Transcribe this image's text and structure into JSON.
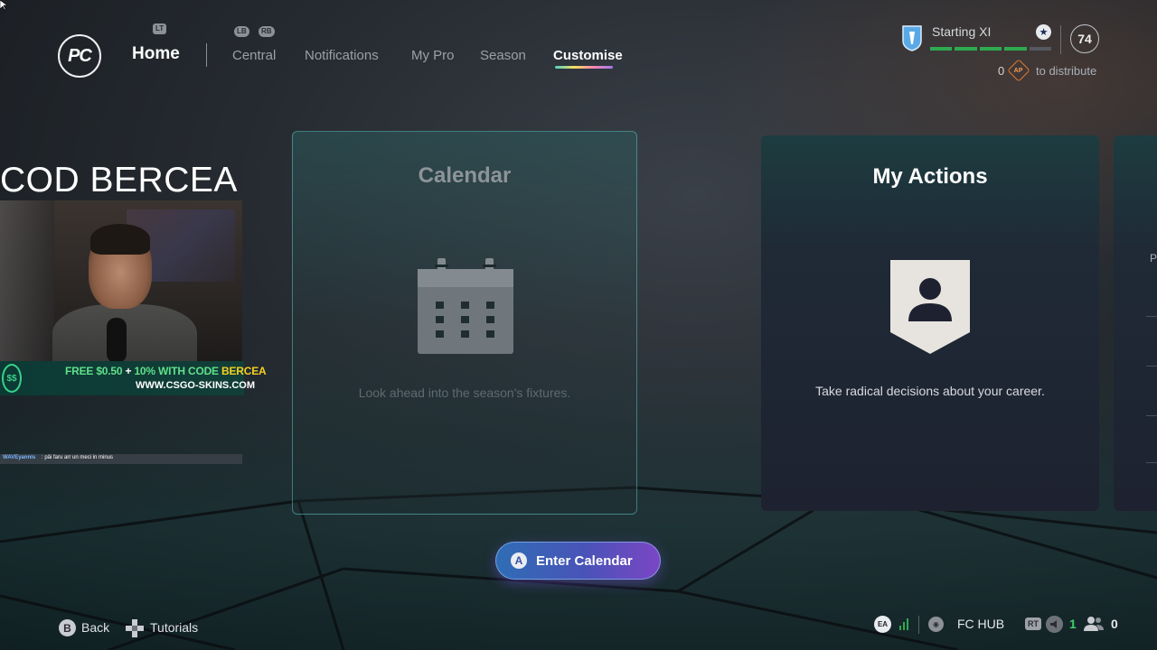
{
  "header": {
    "logo_text": "PC",
    "hint_left_trigger": "LT",
    "hint_left_bumper": "LB",
    "hint_right_bumper": "RB",
    "home_label": "Home",
    "tabs": [
      {
        "label": "Central",
        "active": false
      },
      {
        "label": "Notifications",
        "active": false
      },
      {
        "label": "My Pro",
        "active": false
      },
      {
        "label": "Season",
        "active": false
      },
      {
        "label": "Customise",
        "active": true
      }
    ]
  },
  "status": {
    "squad_name": "Starting XI",
    "overall": "74",
    "ap_count": "0",
    "ap_icon_text": "AP",
    "ap_label": "to distribute",
    "rating_segments_filled": 4,
    "rating_segments_total": 5,
    "accent_green": "#2faa4f"
  },
  "stream_overlay": {
    "code_text": "COD BERCEA",
    "promo_icon": "$$",
    "promo_line1_a": "FREE $0.50",
    "promo_line1_b": " + ",
    "promo_line1_c": "10% WITH CODE ",
    "promo_line1_d": "BERCEA",
    "promo_line2": "WWW.CSGO-SKINS.COM",
    "chat_user": "WAVEyannis",
    "chat_message": ": pâi faru arr un meci in minus"
  },
  "cards": {
    "calendar": {
      "title": "Calendar",
      "description": "Look ahead into the season's fixtures.",
      "icon": "calendar-icon"
    },
    "actions": {
      "title": "My Actions",
      "description": "Take radical decisions about your career.",
      "icon": "person-badge-icon"
    },
    "next_partial_letter": "P"
  },
  "enter_button": {
    "glyph": "A",
    "label": "Enter Calendar",
    "gradient_start": "#2f6db5",
    "gradient_end": "#7b46c4"
  },
  "footer": {
    "back_glyph": "B",
    "back_label": "Back",
    "tutorials_label": "Tutorials",
    "ea_label": "EA",
    "hub_label": "FC HUB",
    "rt_label": "RT",
    "speaker_count": "1",
    "friends_count": "0"
  }
}
